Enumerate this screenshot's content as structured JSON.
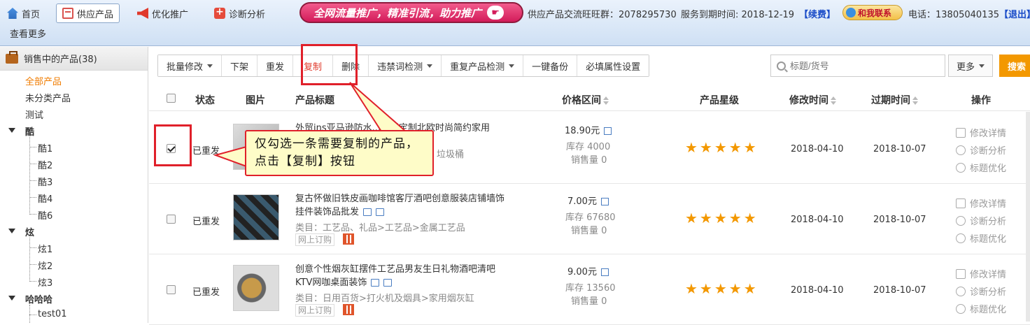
{
  "topnav": {
    "tabs": [
      {
        "label": "首页",
        "icon": "home-icon"
      },
      {
        "label": "供应产品",
        "icon": "product-icon",
        "active": true
      },
      {
        "label": "优化推广",
        "icon": "horn-icon"
      },
      {
        "label": "诊断分析",
        "icon": "medical-icon"
      }
    ],
    "promo": "全网流量推广，精准引流，助力推广",
    "group": "供应产品交流旺旺群：2078295730",
    "expiry": "服务到期时间: 2018-12-19",
    "renew": "【续费】",
    "contact": "和我联系",
    "phone": "电话：13805040135",
    "logout": "【退出】",
    "see_more": "查看更多"
  },
  "sidebar": {
    "header": "销售中的产品(38)",
    "items": [
      {
        "label": "全部产品",
        "selected": true
      },
      {
        "label": "未分类产品"
      },
      {
        "label": "测试"
      }
    ],
    "groups": [
      {
        "label": "酷",
        "children": [
          "酷1",
          "酷2",
          "酷3",
          "酷4",
          "酷6"
        ]
      },
      {
        "label": "炫",
        "children": [
          "炫1",
          "炫2",
          "炫3"
        ]
      },
      {
        "label": "哈哈哈",
        "children": [
          "test01"
        ]
      }
    ]
  },
  "toolbar": {
    "batch_edit": "批量修改",
    "unlist": "下架",
    "republish": "重发",
    "copy": "复制",
    "delete": "删除",
    "banned_check": "违禁词检测",
    "dup_check": "重复产品检测",
    "backup": "一键备份",
    "required_attr": "必填属性设置",
    "search_placeholder": "标题/货号",
    "more": "更多",
    "search": "搜索"
  },
  "table": {
    "headers": {
      "status": "状态",
      "image": "图片",
      "title": "产品标题",
      "price": "价格区间",
      "rating": "产品星级",
      "modified": "修改时间",
      "expires": "过期时间",
      "actions": "操作"
    },
    "rows": [
      {
        "checked": true,
        "status": "已重发",
        "title": "外贸ins亚马逊防水...级桶定制北欧时尚简约家用",
        "category_tail": "垃圾桶",
        "price": "18.90元",
        "stock": "库存 4000",
        "sales": "销售量 0",
        "stars": "★★★★★",
        "modified": "2018-04-10",
        "expires": "2018-10-07"
      },
      {
        "checked": false,
        "status": "已重发",
        "title": "复古怀做旧铁皮画咖啡馆客厅酒吧创意服装店铺墙饰挂件装饰品批发",
        "category": "类目：工艺品、礼品>工艺品>金属工艺品",
        "tag": "网上订购",
        "price": "7.00元",
        "stock": "库存 67680",
        "sales": "销售量 0",
        "stars": "★★★★★",
        "modified": "2018-04-10",
        "expires": "2018-10-07"
      },
      {
        "checked": false,
        "status": "已重发",
        "title": "创意个性烟灰缸摆件工艺品男友生日礼物酒吧清吧KTV网咖桌面装饰",
        "category": "类目：日用百货>打火机及烟具>家用烟灰缸",
        "tag": "网上订购",
        "price": "9.00元",
        "stock": "库存 13560",
        "sales": "销售量 0",
        "stars": "★★★★★",
        "modified": "2018-04-10",
        "expires": "2018-10-07"
      }
    ],
    "actions": [
      "修改详情",
      "诊断分析",
      "标题优化"
    ]
  },
  "annotation": "仅勾选一条需要复制的产品，点击【复制】按钮",
  "colors": {
    "accent": "#f39800",
    "highlight_red": "#e0202a",
    "selected_orange": "#f07c00"
  }
}
